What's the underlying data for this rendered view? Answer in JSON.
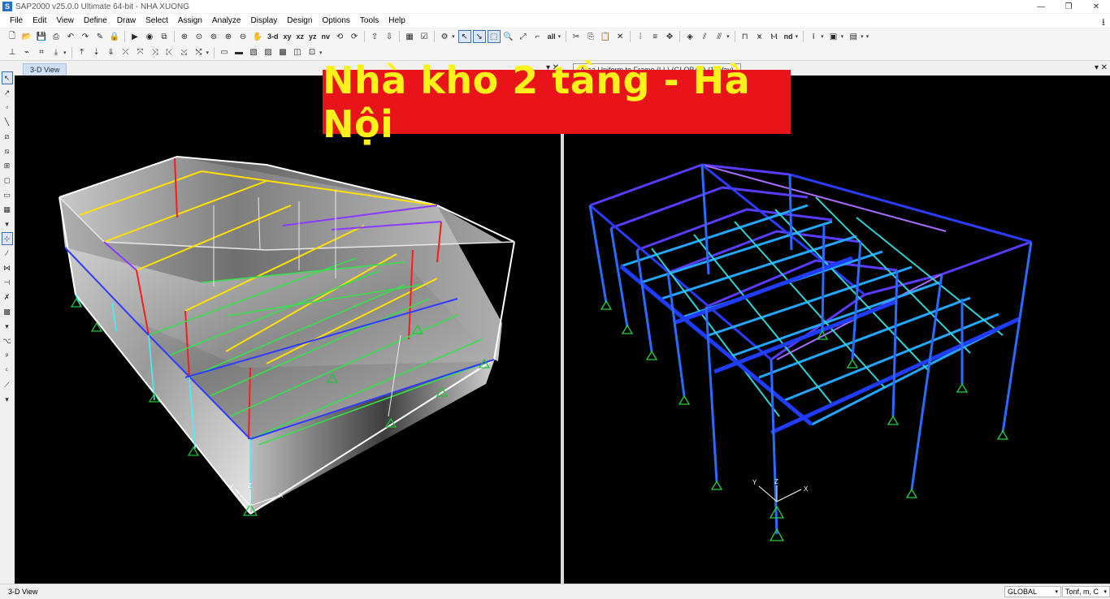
{
  "window": {
    "title": "SAP2000 v25.0.0 Ultimate 64-bit - NHA XUONG",
    "app_icon": "S"
  },
  "menu": [
    "File",
    "Edit",
    "View",
    "Define",
    "Draw",
    "Select",
    "Assign",
    "Analyze",
    "Display",
    "Design",
    "Options",
    "Tools",
    "Help"
  ],
  "toolbar": {
    "view_3d": "3-d",
    "view_xy": "xy",
    "view_xz": "xz",
    "view_yz": "yz",
    "view_nv": "nv",
    "select_all": "all",
    "select_nd": "nd"
  },
  "tabs": {
    "left": "3-D View",
    "right": "Area Uniform to Frame (LL) (GLOBAL) (1-Way)"
  },
  "banner": {
    "text": "Nhà kho 2 tầng  - Hà Nội"
  },
  "axes": {
    "x": "X",
    "y": "Y",
    "z": "Z"
  },
  "status": {
    "view": "3-D View",
    "coord_system": "GLOBAL",
    "units": "Tonf, m, C"
  },
  "colors": {
    "banner_bg": "#e8141a",
    "banner_text": "#fff21b",
    "viewport_bg": "#000000"
  }
}
